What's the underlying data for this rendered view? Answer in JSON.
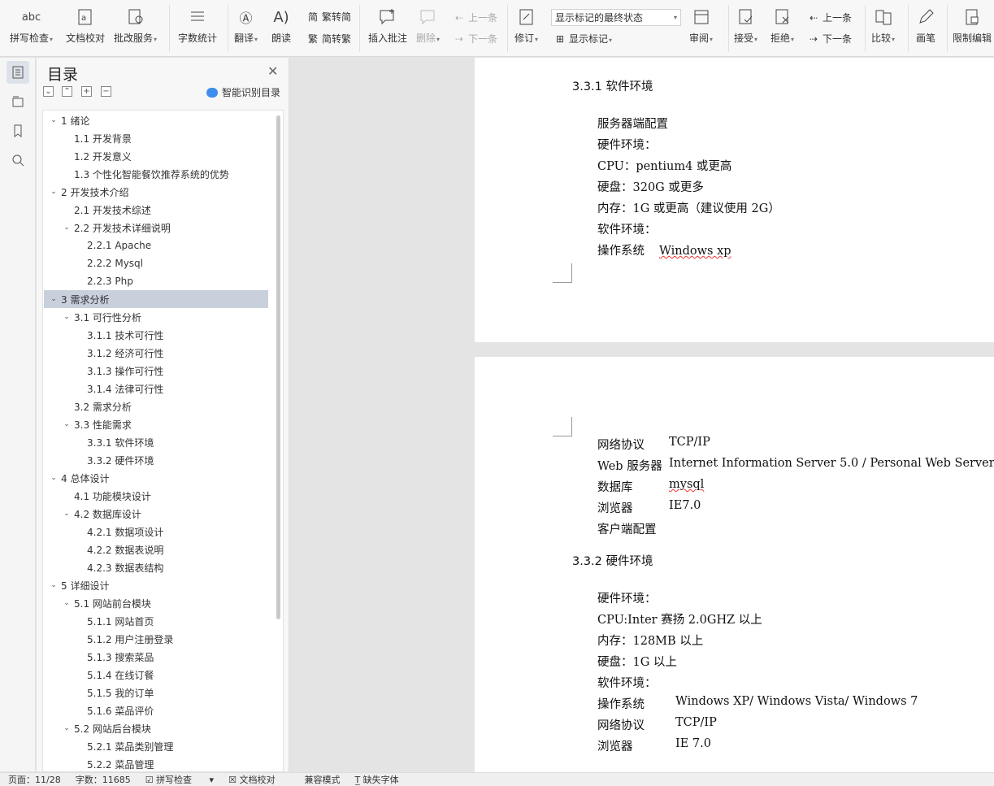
{
  "ribbon": {
    "spell": {
      "icon": "abc",
      "label": "拼写检查"
    },
    "proof": {
      "label": "文档校对"
    },
    "correct": {
      "label": "批改服务"
    },
    "wordcount": {
      "label": "字数统计"
    },
    "translate": {
      "label": "翻译"
    },
    "read": {
      "label": "朗读"
    },
    "t2s": {
      "label": "繁转简"
    },
    "s2t": {
      "label": "简转繁"
    },
    "insert_comment": {
      "label": "插入批注"
    },
    "delete": {
      "label": "删除"
    },
    "prev_comment": {
      "label": "上一条"
    },
    "next_comment": {
      "label": "下一条"
    },
    "revise": {
      "label": "修订"
    },
    "markup_select": {
      "value": "显示标记的最终状态"
    },
    "show_markup": {
      "label": "显示标记"
    },
    "review": {
      "label": "审阅"
    },
    "accept": {
      "label": "接受"
    },
    "reject": {
      "label": "拒绝"
    },
    "prev_change": {
      "label": "上一条"
    },
    "next_change": {
      "label": "下一条"
    },
    "compare": {
      "label": "比较"
    },
    "pen": {
      "label": "画笔"
    },
    "restrict": {
      "label": "限制编辑"
    }
  },
  "toc": {
    "title": "目录",
    "smart": "智能识别目录",
    "items": [
      {
        "text": "1  绪论",
        "level": 1,
        "arrow": "v"
      },
      {
        "text": "1.1  开发背景",
        "level": 2,
        "arrow": ""
      },
      {
        "text": "1.2  开发意义",
        "level": 2,
        "arrow": ""
      },
      {
        "text": "1.3  个性化智能餐饮推荐系统的优势",
        "level": 2,
        "arrow": ""
      },
      {
        "text": "2  开发技术介绍",
        "level": 1,
        "arrow": "v"
      },
      {
        "text": "2.1  开发技术综述",
        "level": 2,
        "arrow": ""
      },
      {
        "text": "2.2  开发技术详细说明",
        "level": 2,
        "arrow": "v"
      },
      {
        "text": "2.2.1  Apache",
        "level": 3,
        "arrow": ""
      },
      {
        "text": "2.2.2  Mysql",
        "level": 3,
        "arrow": ""
      },
      {
        "text": "2.2.3  Php",
        "level": 3,
        "arrow": ""
      },
      {
        "text": "3  需求分析",
        "level": 1,
        "arrow": "v"
      },
      {
        "text": "3.1  可行性分析",
        "level": 2,
        "arrow": "v"
      },
      {
        "text": "3.1.1  技术可行性",
        "level": 3,
        "arrow": ""
      },
      {
        "text": "3.1.2  经济可行性",
        "level": 3,
        "arrow": ""
      },
      {
        "text": "3.1.3  操作可行性",
        "level": 3,
        "arrow": ""
      },
      {
        "text": "3.1.4  法律可行性",
        "level": 3,
        "arrow": ""
      },
      {
        "text": "3.2  需求分析",
        "level": 2,
        "arrow": ""
      },
      {
        "text": "3.3  性能需求",
        "level": 2,
        "arrow": "v"
      },
      {
        "text": "3.3.1  软件环境",
        "level": 3,
        "arrow": ""
      },
      {
        "text": "3.3.2  硬件环境",
        "level": 3,
        "arrow": ""
      },
      {
        "text": "4  总体设计",
        "level": 1,
        "arrow": "v"
      },
      {
        "text": "4.1  功能模块设计",
        "level": 2,
        "arrow": ""
      },
      {
        "text": "4.2  数据库设计",
        "level": 2,
        "arrow": "v"
      },
      {
        "text": "4.2.1  数据项设计",
        "level": 3,
        "arrow": ""
      },
      {
        "text": "4.2.2  数据表说明",
        "level": 3,
        "arrow": ""
      },
      {
        "text": "4.2.3  数据表结构",
        "level": 3,
        "arrow": ""
      },
      {
        "text": "5  详细设计",
        "level": 1,
        "arrow": "v"
      },
      {
        "text": "5.1  网站前台模块",
        "level": 2,
        "arrow": "v"
      },
      {
        "text": "5.1.1  网站首页",
        "level": 3,
        "arrow": ""
      },
      {
        "text": "5.1.2  用户注册登录",
        "level": 3,
        "arrow": ""
      },
      {
        "text": "5.1.3  搜索菜品",
        "level": 3,
        "arrow": ""
      },
      {
        "text": "5.1.4  在线订餐",
        "level": 3,
        "arrow": ""
      },
      {
        "text": "5.1.5  我的订单",
        "level": 3,
        "arrow": ""
      },
      {
        "text": "5.1.6  菜品评价",
        "level": 3,
        "arrow": ""
      },
      {
        "text": "5.2  网站后台模块",
        "level": 2,
        "arrow": "v"
      },
      {
        "text": "5.2.1  菜品类别管理",
        "level": 3,
        "arrow": ""
      },
      {
        "text": "5.2.2  菜品管理",
        "level": 3,
        "arrow": ""
      }
    ]
  },
  "doc": {
    "page1": {
      "heading": "3.3.1   软件环境",
      "lines": [
        "服务器端配置",
        "硬件环境：",
        "CPU：pentium4 或更高",
        "硬盘：320G 或更多",
        "内存：1G 或更高（建议使用 2G）",
        "软件环境："
      ],
      "os_label": "操作系统",
      "os_value": "Windows xp"
    },
    "page2": {
      "rows": [
        {
          "label": "网络协议",
          "value": "TCP/IP"
        },
        {
          "label": "Web 服务器",
          "value": "Internet Information Server 5.0 / Personal Web Server"
        },
        {
          "label": "数据库",
          "value": "mysql"
        },
        {
          "label": "浏览器",
          "value": "IE7.0"
        }
      ],
      "client": "客户端配置",
      "heading": "3.3.2   硬件环境",
      "lines": [
        "硬件环境：",
        "CPU:Inter 赛扬 2.0GHZ 以上",
        "内存：128MB 以上",
        "硬盘：1G 以上",
        "软件环境："
      ],
      "rows2": [
        {
          "label": "操作系统",
          "value": "Windows XP/ Windows Vista/ Windows 7"
        },
        {
          "label": "网络协议",
          "value": "TCP/IP"
        },
        {
          "label": "浏览器",
          "value": "IE 7.0"
        }
      ]
    }
  },
  "status": {
    "page": "页面：11/28",
    "words": "字数：11685",
    "spell": "拼写检查",
    "proof": "文档校对",
    "compat": "兼容模式",
    "missing_font": "缺失字体"
  }
}
